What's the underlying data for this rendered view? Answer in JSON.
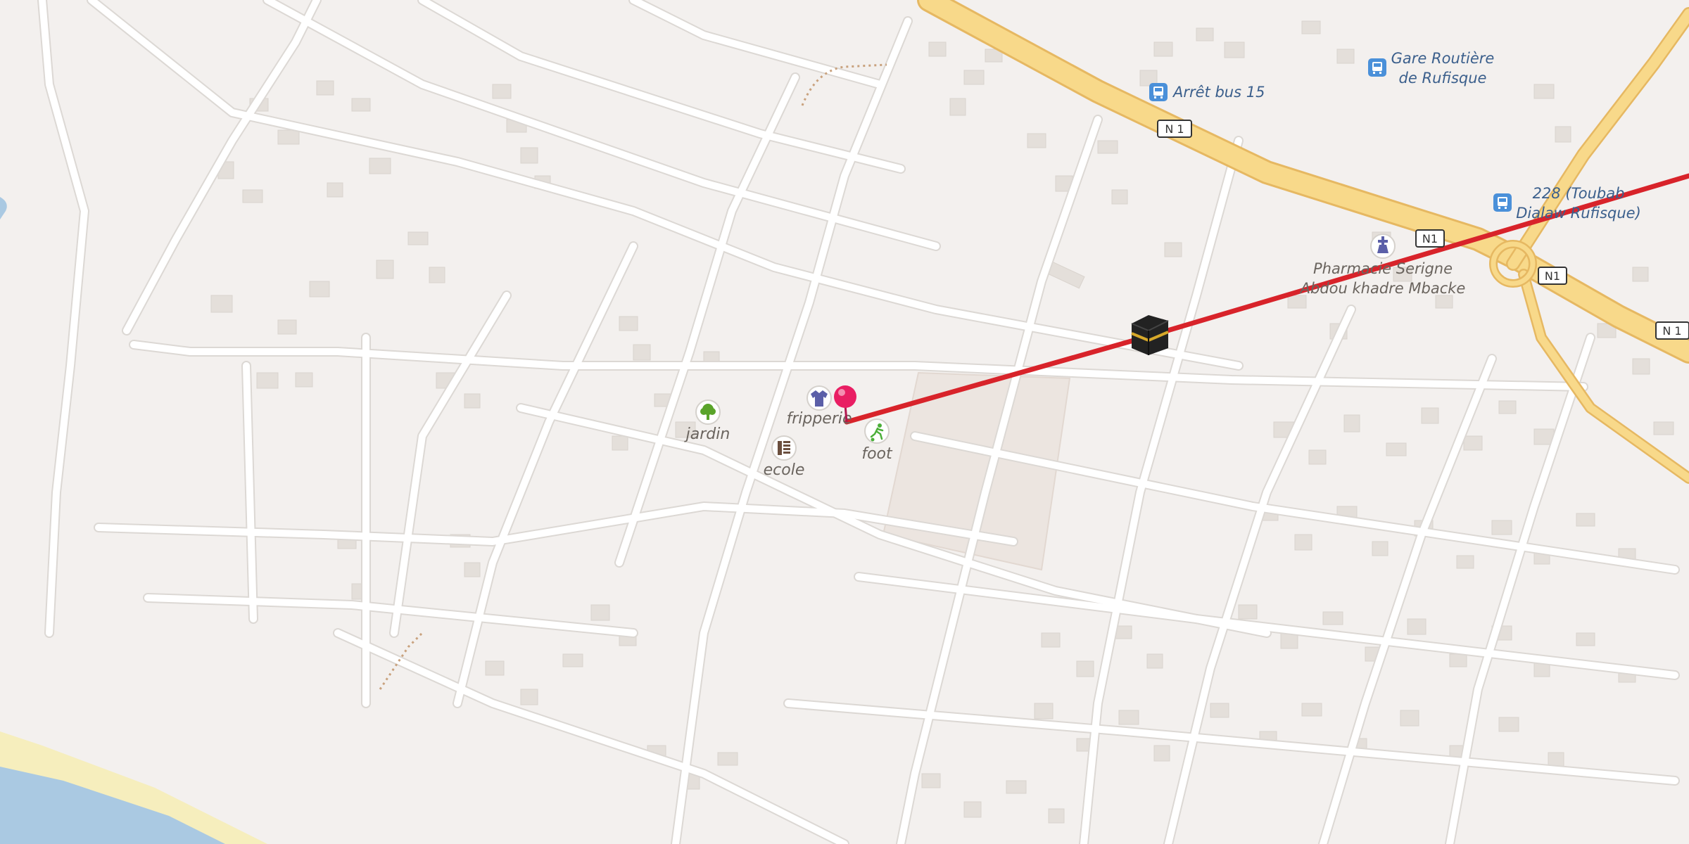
{
  "map": {
    "colors": {
      "land": "#f3f0ee",
      "street": "#ffffff",
      "street_casing": "#dcd8d4",
      "highway": "#f8d98a",
      "highway_casing": "#e6b862",
      "building": "#e4dfda",
      "sea": "#aac9e2",
      "beach": "#f6eebd",
      "route": "#d8232a",
      "pin": "#e91e63",
      "label_text": "#5f5a55",
      "transit_label": "#3b5f8c"
    },
    "route": {
      "color": "#d8232a",
      "start_marker": "red-pin",
      "end_marker": "kaaba"
    }
  },
  "pois": {
    "arret_bus_15": {
      "label": "Arrêt bus 15",
      "icon": "bus-stop-icon"
    },
    "gare_routiere": {
      "label_line1": "Gare Routière",
      "label_line2": "de Rufisque",
      "icon": "bus-station-icon"
    },
    "bus_228": {
      "label_line1": "228 (Toubab",
      "label_line2": "Dialaw Rufisque)",
      "icon": "bus-stop-icon"
    },
    "pharmacie": {
      "label_line1": "Pharmacie Serigne",
      "label_line2": "Abdou khadre Mbacke",
      "icon": "pharmacy-icon"
    },
    "fripperie": {
      "label": "fripperie",
      "icon": "clothes-shop-icon"
    },
    "jardin": {
      "label": "jardin",
      "icon": "tree-icon"
    },
    "ecole": {
      "label": "ecole",
      "icon": "school-icon"
    },
    "foot": {
      "label": "foot",
      "icon": "football-icon"
    },
    "kaaba": {
      "icon": "kaaba-icon"
    }
  },
  "road_shields": [
    {
      "name": "n1-shield-a",
      "label": "N 1"
    },
    {
      "name": "n1-shield-b",
      "label": "N1"
    },
    {
      "name": "n1-shield-c",
      "label": "N1"
    },
    {
      "name": "n1-shield-d",
      "label": "N 1"
    }
  ]
}
